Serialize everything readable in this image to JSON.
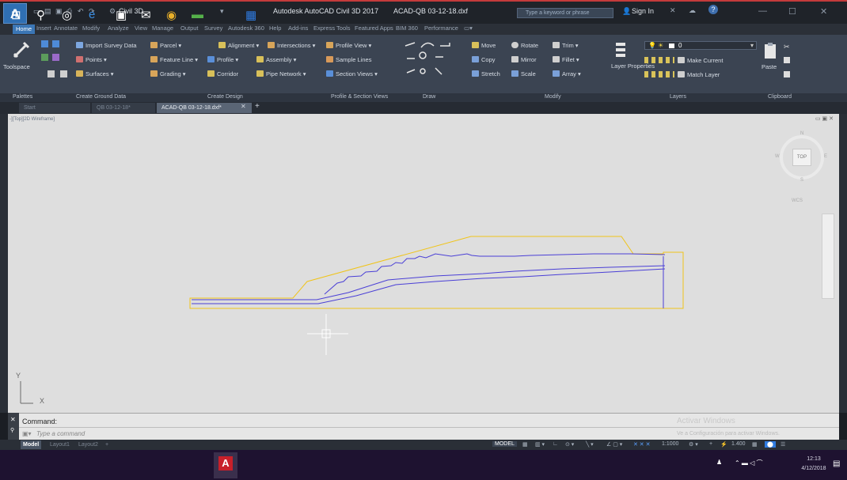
{
  "titlebar": {
    "logo": "A",
    "workspace": "Civil 3D",
    "app_title": "Autodesk AutoCAD Civil 3D 2017",
    "file_title": "ACAD-QB 03-12-18.dxf",
    "search_placeholder": "Type a keyword or phrase",
    "sign_in": "Sign In",
    "help": "?"
  },
  "ribbon_tabs": [
    "Home",
    "Insert",
    "Annotate",
    "Modify",
    "Analyze",
    "View",
    "Manage",
    "Output",
    "Survey",
    "Autodesk 360",
    "Help",
    "Add-ins",
    "Express Tools",
    "Featured Apps",
    "BIM 360",
    "Performance"
  ],
  "ribbon": {
    "toolspace": "Toolspace",
    "import_survey": "Import Survey Data",
    "points": "Points",
    "surfaces": "Surfaces",
    "parcel": "Parcel",
    "feature_line": "Feature Line",
    "grading": "Grading",
    "profile": "Profile",
    "corridor": "Corridor",
    "alignment": "Alignment",
    "assembly": "Assembly",
    "pipe_network": "Pipe Network",
    "intersections": "Intersections",
    "profile_view": "Profile View",
    "sample_lines": "Sample Lines",
    "section_views": "Section Views",
    "move": "Move",
    "copy": "Copy",
    "stretch": "Stretch",
    "rotate": "Rotate",
    "mirror": "Mirror",
    "scale": "Scale",
    "trim": "Trim",
    "fillet": "Fillet",
    "array": "Array",
    "layer_properties": "Layer Properties",
    "layer_value": "0",
    "make_current": "Make Current",
    "match_layer": "Match Layer",
    "paste": "Paste"
  },
  "panels": [
    "Palettes",
    "Create Ground Data",
    "Create Design",
    "Profile & Section Views",
    "Draw",
    "Modify",
    "Layers",
    "Clipboard"
  ],
  "doc_tabs": [
    "Start",
    "QB 03-12-18*",
    "ACAD-QB 03-12-18.dxf*"
  ],
  "viewport_label": "-][Top][2D Wireframe]",
  "viewcube": {
    "top": "TOP",
    "n": "N",
    "w": "W",
    "e": "E",
    "s": "S",
    "wcs": "WCS"
  },
  "ucs": {
    "x": "X",
    "y": "Y"
  },
  "command": {
    "label": "Command:",
    "placeholder": "Type a command"
  },
  "watermark": {
    "line1": "Activar Windows",
    "line2": "Ve a Configuración para activar Windows."
  },
  "layout_tabs": [
    "Model",
    "Layout1",
    "Layout2",
    "+"
  ],
  "status": {
    "model": "MODEL",
    "scale": "1:1000",
    "value": "1.400"
  },
  "taskbar": {
    "time": "12:13",
    "date": "4/12/2018"
  },
  "colors": {
    "accent": "#3b76b5",
    "profile_yellow": "#f0c419",
    "profile_blue": "#4a3fd6"
  }
}
